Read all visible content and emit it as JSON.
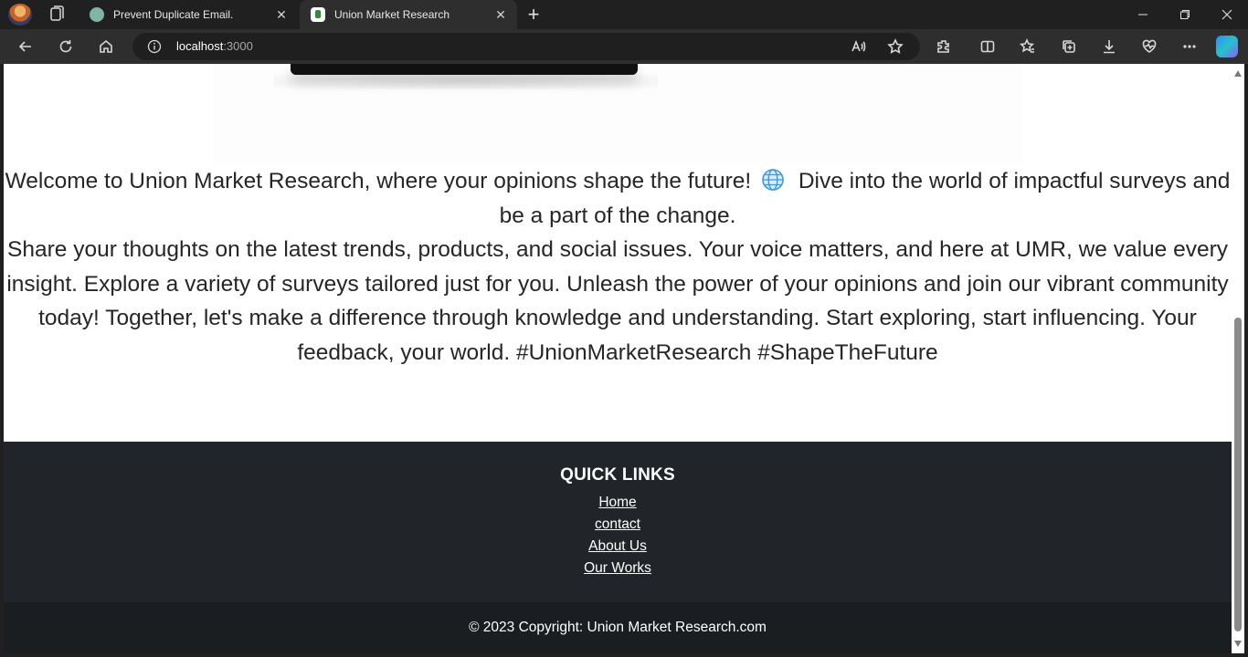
{
  "tabs": [
    {
      "title": "Prevent Duplicate Email.",
      "favicon": "chatgpt-icon",
      "active": false
    },
    {
      "title": "Union Market Research",
      "favicon": "umr-icon",
      "active": true
    }
  ],
  "address": {
    "host": "localhost",
    "port": ":3000"
  },
  "intro": {
    "line1_before_icon": "Welcome to Union Market Research, where your opinions shape the future!",
    "icon": "globe-icon",
    "line1_after_icon": "Dive into the world of impactful surveys and be a part of the change.",
    "paragraph2": "Share your thoughts on the latest trends, products, and social issues. Your voice matters, and here at UMR, we value every insight. Explore a variety of surveys tailored just for you. Unleash the power of your opinions and join our vibrant community today! Together, let's make a difference through knowledge and understanding. Start exploring, start influencing. Your feedback, your world. #UnionMarketResearch #ShapeTheFuture"
  },
  "footer": {
    "heading": "QUICK LINKS",
    "links": [
      "Home",
      "contact",
      "About Us",
      "Our Works"
    ],
    "copyright": "© 2023 Copyright: Union Market Research.com"
  },
  "colors": {
    "browser_chrome": "#202020",
    "toolbar": "#2e2e2e",
    "footer_bg": "#212529",
    "copyright_bg": "#1b1e21",
    "page_bg": "#ffffff",
    "body_text": "#262626"
  }
}
